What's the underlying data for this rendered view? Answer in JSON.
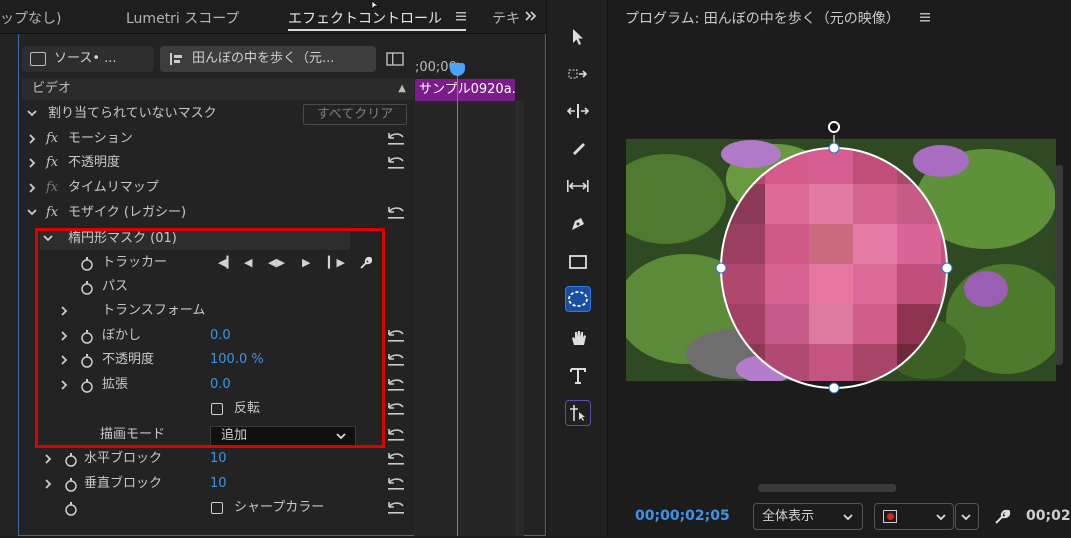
{
  "left_tabs": {
    "tab1": "ップなし)",
    "tab2": "Lumetri スコープ",
    "tab3": "エフェクトコントロール",
    "tab4": "テキ",
    "menu_icon": "hamburger-icon",
    "more_icon": "double-chevron-right-icon"
  },
  "source_row": {
    "source_label": "ソース• ...",
    "sequence_label": "田んぼの中を歩く（元..."
  },
  "timeline": {
    "ruler_text": ";00;00",
    "clip_label": "サンプル0920a."
  },
  "video_header": "ビデオ",
  "unassigned_mask": {
    "label": "割り当てられていないマスク",
    "clear_button": "すべてクリア"
  },
  "effects": [
    {
      "label": "モーション"
    },
    {
      "label": "不透明度"
    },
    {
      "label": "タイムリマップ"
    },
    {
      "label": "モザイク (レガシー)"
    }
  ],
  "mask": {
    "title": "楕円形マスク (01)",
    "tracker_label": "トラッカー",
    "path_label": "パス",
    "transform_label": "トランスフォーム",
    "feather_label": "ぼかし",
    "feather_value": "0.0",
    "opacity_label": "不透明度",
    "opacity_value": "100.0 %",
    "expansion_label": "拡張",
    "expansion_value": "0.0",
    "invert_label": "反転",
    "blend_mode_label": "描画モード",
    "blend_mode_value": "追加"
  },
  "mosaic": {
    "h_blocks_label": "水平ブロック",
    "h_blocks_value": "10",
    "v_blocks_label": "垂直ブロック",
    "v_blocks_value": "10",
    "sharp_colors_label": "シャープカラー"
  },
  "tools": [
    "selection-tool-icon",
    "track-select-tool-icon",
    "ripple-edit-tool-icon",
    "razor-tool-icon",
    "slip-tool-icon",
    "pen-tool-icon",
    "rectangle-tool-icon",
    "ellipse-tool-icon",
    "hand-tool-icon",
    "type-tool-icon",
    "position-tool-icon"
  ],
  "program": {
    "title": "プログラム: 田んぼの中を歩く（元の映像）",
    "timecode": "00;00;02;05",
    "fit_value": "全体表示",
    "right_timecode": "00;02"
  },
  "colors": {
    "accent_blue": "#3d94e6",
    "clip_purple": "#7a1d8b",
    "highlight_red": "#e00000"
  }
}
